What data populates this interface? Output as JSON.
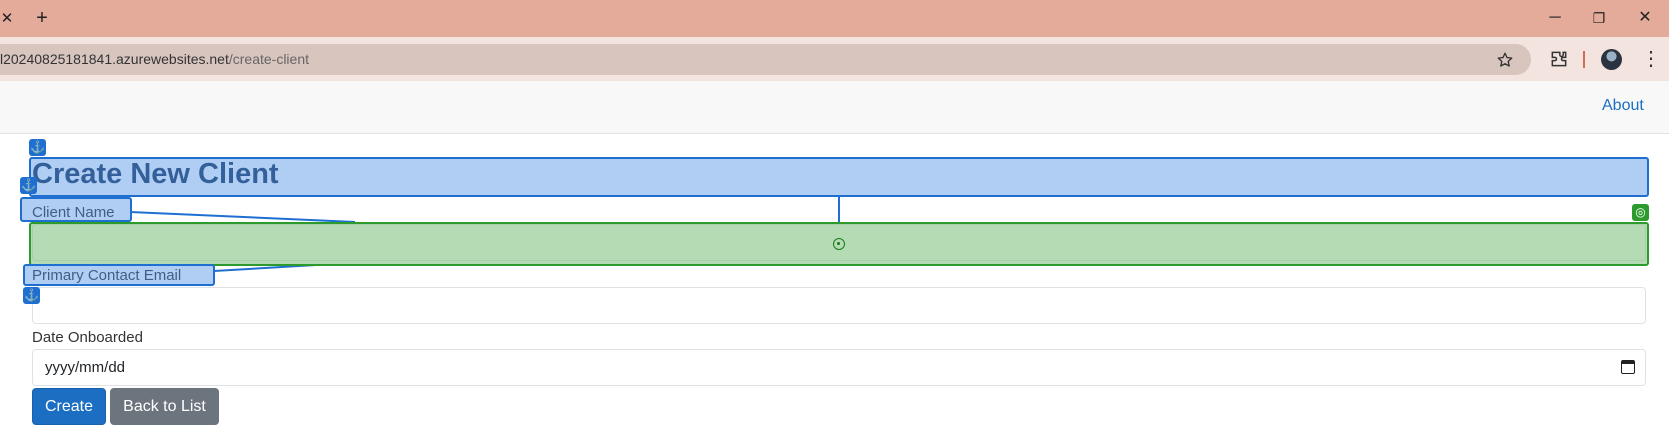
{
  "browser": {
    "tab_close_glyph": "✕",
    "new_tab_glyph": "+",
    "window_controls": {
      "minimize": "─",
      "restore": "❐",
      "close": "✕"
    },
    "url_host": "l20240825181841.azurewebsites.net",
    "url_path": "/create-client",
    "icons": [
      "star-icon",
      "extensions-icon",
      "profile-avatar",
      "menu-icon"
    ]
  },
  "nav": {
    "about": "About"
  },
  "form": {
    "title": "Create New Client",
    "client_name_label": "Client Name",
    "client_name_value": "",
    "email_label": "Primary Contact Email",
    "email_value": "",
    "date_label": "Date Onboarded",
    "date_placeholder": "yyyy/mm/dd",
    "create_button": "Create",
    "back_button": "Back to List"
  },
  "overlay": {
    "anchor_glyph": "⚓",
    "target_glyph": "◎",
    "colors": {
      "source": "#1f6fd1",
      "target": "#2c9a2c"
    }
  }
}
